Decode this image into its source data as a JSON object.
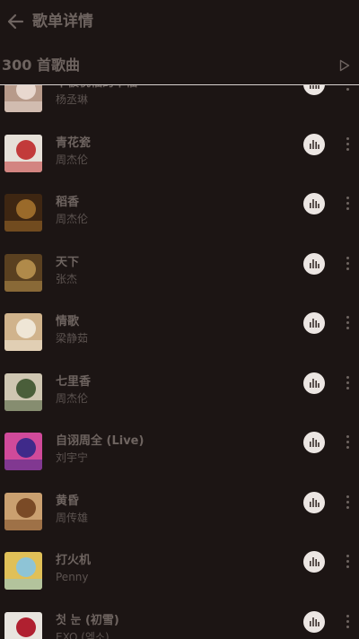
{
  "header": {
    "title": "歌单详情"
  },
  "playlist": {
    "count_label": "300 首歌曲"
  },
  "songs": [
    {
      "title": "不被祝福的幸福",
      "artist": "杨丞琳",
      "cover": [
        "#e8d8cf",
        "#b79a8a"
      ]
    },
    {
      "title": "青花瓷",
      "artist": "周杰伦",
      "cover": [
        "#c23a3a",
        "#e6e0d8"
      ]
    },
    {
      "title": "稻香",
      "artist": "周杰伦",
      "cover": [
        "#9a6a2a",
        "#3e2612"
      ]
    },
    {
      "title": "天下",
      "artist": "张杰",
      "cover": [
        "#b08a4a",
        "#5a4020"
      ]
    },
    {
      "title": "情歌",
      "artist": "梁静茹",
      "cover": [
        "#efe6d6",
        "#d0b38c"
      ]
    },
    {
      "title": "七里香",
      "artist": "周杰伦",
      "cover": [
        "#4a5e3a",
        "#cfc6b2"
      ]
    },
    {
      "title": "自诩周全 (Live)",
      "artist": "刘宇宁",
      "cover": [
        "#3f2a8a",
        "#d04a9a"
      ]
    },
    {
      "title": "黄昏",
      "artist": "周传雄",
      "cover": [
        "#7a4a26",
        "#caa070"
      ]
    },
    {
      "title": "打火机",
      "artist": "Penny",
      "cover": [
        "#8ec4d6",
        "#e0c058"
      ]
    },
    {
      "title": "첫 눈 (初雪)",
      "artist": "EXO (엑소)",
      "cover": [
        "#b02030",
        "#e8e4de"
      ]
    }
  ]
}
